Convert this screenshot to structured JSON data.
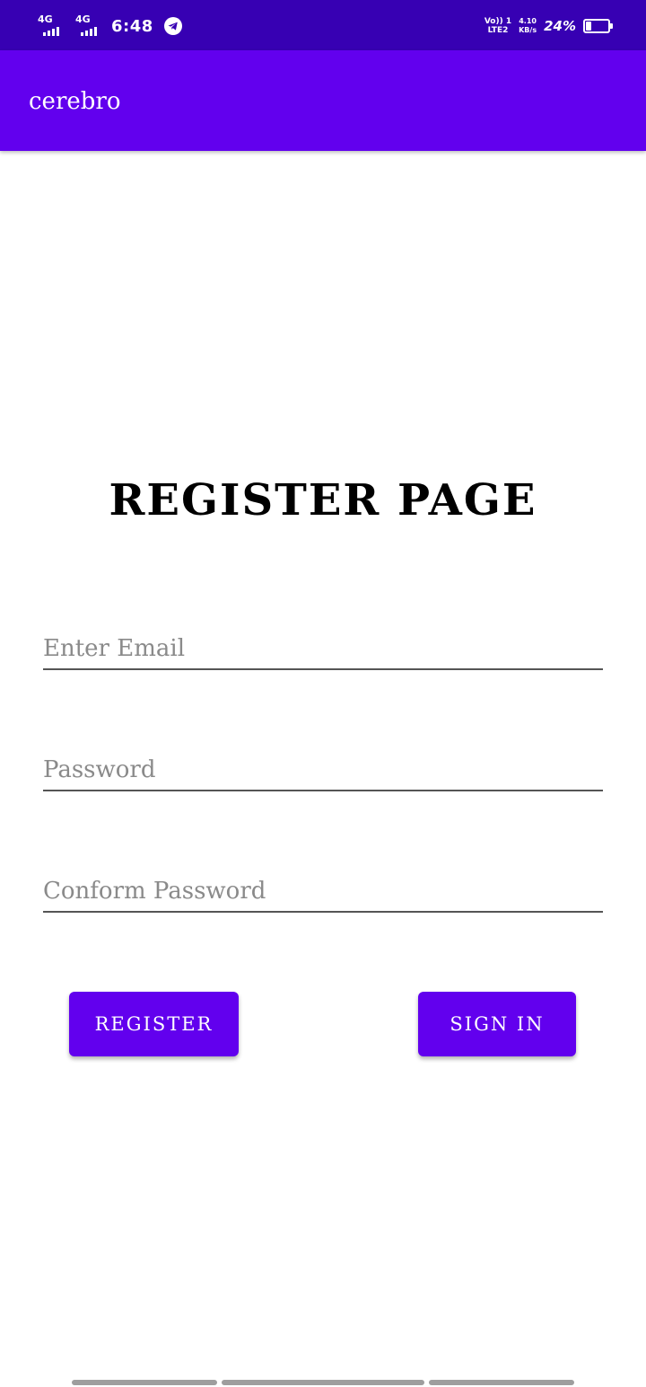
{
  "status_bar": {
    "sim1_network": "4G",
    "sim2_network": "4G",
    "time": "6:48",
    "app_icon": "telegram-icon",
    "volte_line1": "Vo)) 1",
    "volte_line2": "LTE2",
    "speed_value": "4.10",
    "speed_unit": "KB/s",
    "battery_percent": "24%",
    "battery_level": 0.24
  },
  "app_bar": {
    "title": "cerebro",
    "color": "#6200ee"
  },
  "page": {
    "heading": "REGISTER PAGE"
  },
  "form": {
    "email_placeholder": "Enter Email",
    "password_placeholder": "Password",
    "confirm_password_placeholder": "Conform Password"
  },
  "buttons": {
    "register_label": "REGISTER",
    "sign_in_label": "SIGN IN",
    "color": "#6200ee"
  }
}
